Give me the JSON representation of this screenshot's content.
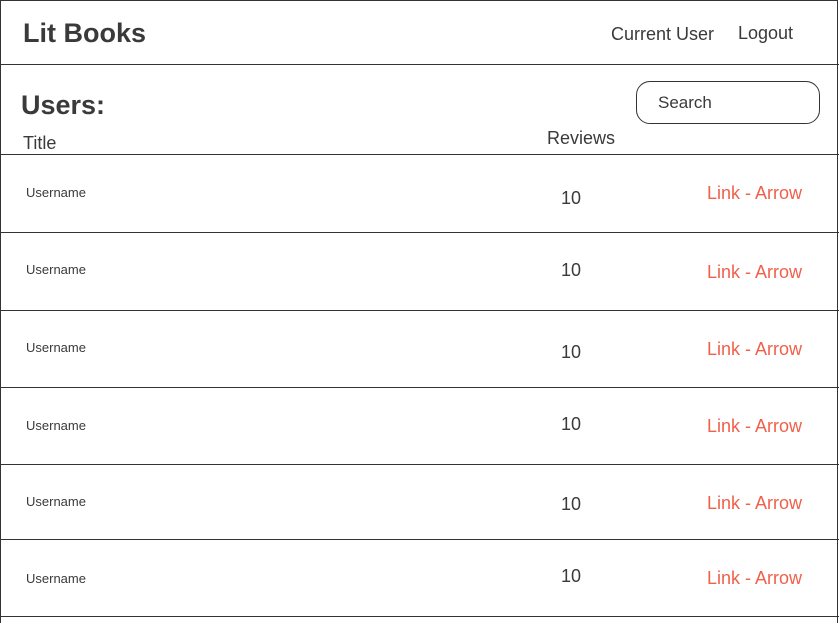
{
  "header": {
    "brand": "Lit Books",
    "nav": {
      "current_user": "Current User",
      "logout": "Logout"
    }
  },
  "page": {
    "title": "Users:",
    "search": {
      "placeholder": "Search",
      "value": ""
    }
  },
  "table": {
    "columns": {
      "title": "Title",
      "reviews": "Reviews"
    },
    "rows": [
      {
        "username": "Username",
        "reviews": "10",
        "link": "Link - Arrow"
      },
      {
        "username": "Username",
        "reviews": "10",
        "link": "Link - Arrow"
      },
      {
        "username": "Username",
        "reviews": "10",
        "link": "Link - Arrow"
      },
      {
        "username": "Username",
        "reviews": "10",
        "link": "Link - Arrow"
      },
      {
        "username": "Username",
        "reviews": "10",
        "link": "Link - Arrow"
      },
      {
        "username": "Username",
        "reviews": "10",
        "link": "Link - Arrow"
      }
    ]
  },
  "colors": {
    "link": "#f0604a",
    "text": "#3a3a3a",
    "border": "#333333"
  }
}
